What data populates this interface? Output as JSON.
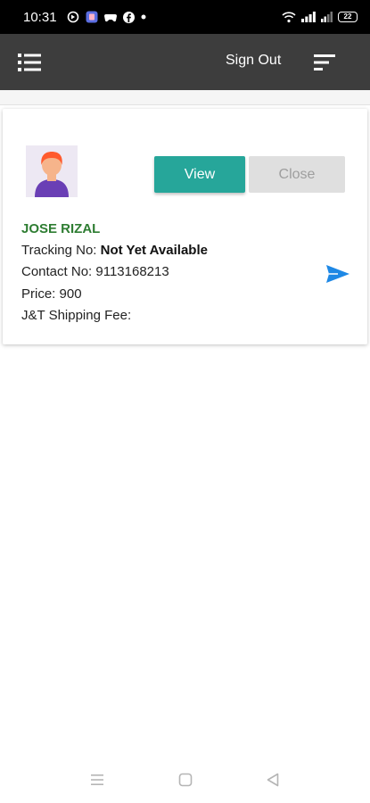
{
  "status_bar": {
    "time": "10:31",
    "battery": "22",
    "icons": [
      "data-saver-icon",
      "app-notification-icon",
      "game-controller-icon",
      "facebook-icon",
      "dot-icon",
      "wifi-icon",
      "signal-icon",
      "signal-icon-2",
      "battery-icon"
    ]
  },
  "app_bar": {
    "menu_icon": "list-menu-icon",
    "signout_label": "Sign Out",
    "sort_icon": "sort-icon"
  },
  "order": {
    "avatar_icon": "user-avatar-icon",
    "view_label": "View",
    "close_label": "Close",
    "name": "JOSE RIZAL",
    "tracking_label": "Tracking No: ",
    "tracking_value": "Not Yet Available",
    "contact_label": "Contact No: ",
    "contact_value": "9113168213",
    "price_label": "Price: ",
    "price_value": "900",
    "shipping_label": "J&T Shipping Fee:",
    "send_icon": "send-icon"
  },
  "nav": {
    "recents_icon": "recents-icon",
    "home_icon": "home-icon",
    "back_icon": "back-icon"
  },
  "colors": {
    "app_bar": "#3d3d3d",
    "view_button": "#26a69a",
    "name_text": "#2e7d32",
    "send_icon": "#1e88e5"
  }
}
